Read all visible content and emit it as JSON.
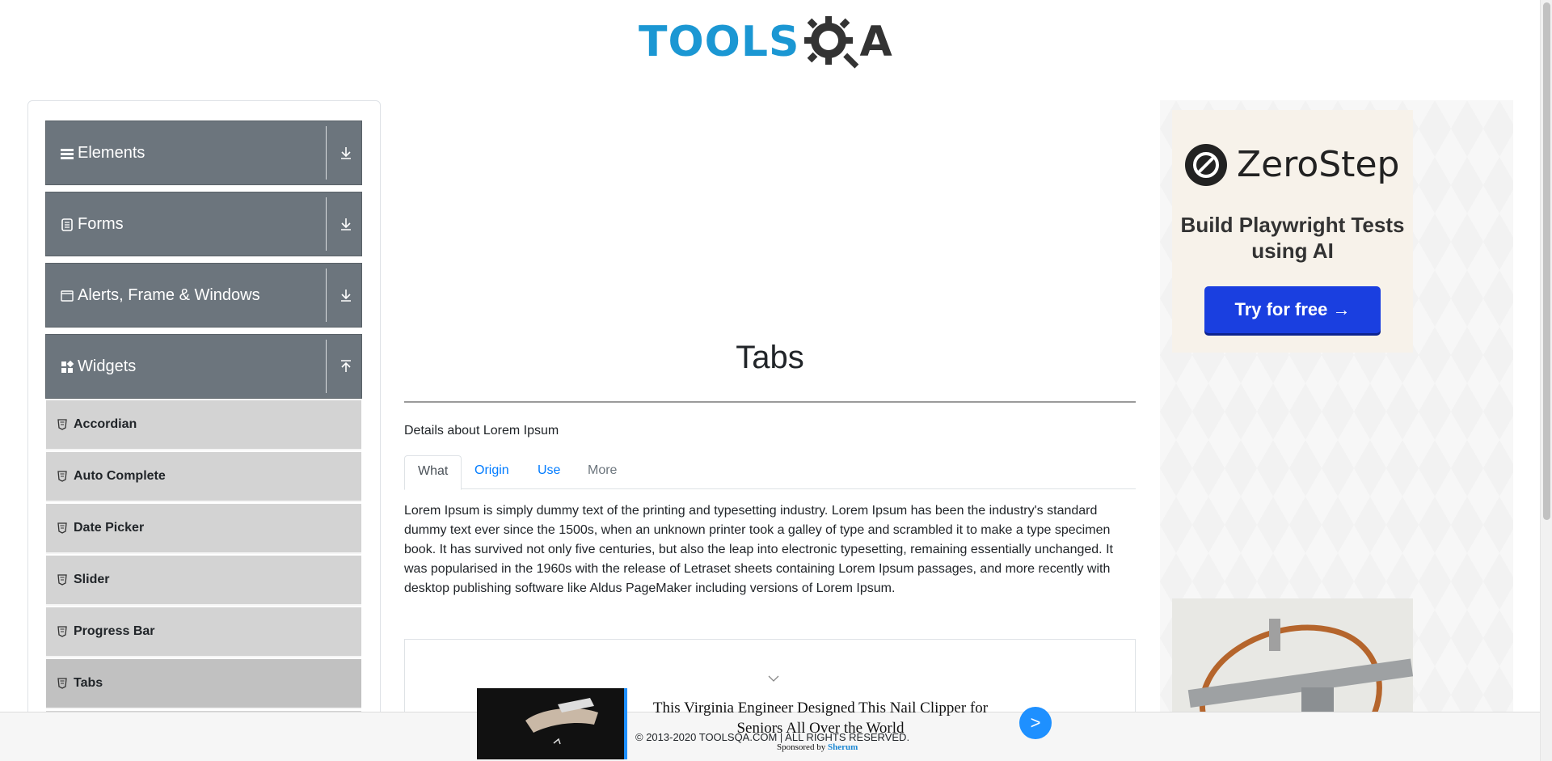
{
  "header": {
    "logo_text_left": "TOOLS",
    "logo_text_right": "A",
    "logo_alt": "TOOLSQA"
  },
  "sidebar": {
    "groups": [
      {
        "label": "Elements",
        "icon": "hamburger-icon",
        "state": "collapsed"
      },
      {
        "label": "Forms",
        "icon": "form-icon",
        "state": "collapsed"
      },
      {
        "label": "Alerts, Frame & Windows",
        "icon": "window-icon",
        "state": "collapsed"
      },
      {
        "label": "Widgets",
        "icon": "widgets-icon",
        "state": "expanded"
      }
    ],
    "items": [
      {
        "label": "Accordian"
      },
      {
        "label": "Auto Complete"
      },
      {
        "label": "Date Picker"
      },
      {
        "label": "Slider"
      },
      {
        "label": "Progress Bar"
      },
      {
        "label": "Tabs",
        "active": true
      }
    ]
  },
  "main": {
    "title": "Tabs",
    "details": "Details about Lorem Ipsum",
    "tabs": [
      {
        "label": "What",
        "state": "active"
      },
      {
        "label": "Origin",
        "state": "normal"
      },
      {
        "label": "Use",
        "state": "normal"
      },
      {
        "label": "More",
        "state": "disabled"
      }
    ],
    "content": "Lorem Ipsum is simply dummy text of the printing and typesetting industry. Lorem Ipsum has been the industry's standard dummy text ever since the 1500s, when an unknown printer took a galley of type and scrambled it to make a type specimen book. It has survived not only five centuries, but also the leap into electronic typesetting, remaining essentially unchanged. It was popularised in the 1960s with the release of Letraset sheets containing Lorem Ipsum passages, and more recently with desktop publishing software like Aldus PageMaker including versions of Lorem Ipsum."
  },
  "right_ad": {
    "brand": "ZeroStep",
    "tagline": "Build Playwright Tests using AI",
    "cta": "Try for free →"
  },
  "bottom_ad": {
    "headline": "This Virginia Engineer Designed This Nail Clipper for Seniors All Over the World",
    "sponsored_prefix": "Sponsored by",
    "sponsor": "Sherum",
    "next": ">"
  },
  "footer": {
    "copyright": "© 2013-2020 TOOLSQA.COM | ALL RIGHTS RESERVED."
  },
  "colors": {
    "brand_blue": "#1b97d3",
    "menu_group_bg": "#6c757d",
    "menu_item_bg": "#d3d3d3",
    "link_blue": "#007bff",
    "cta_blue": "#1a3fe0"
  }
}
